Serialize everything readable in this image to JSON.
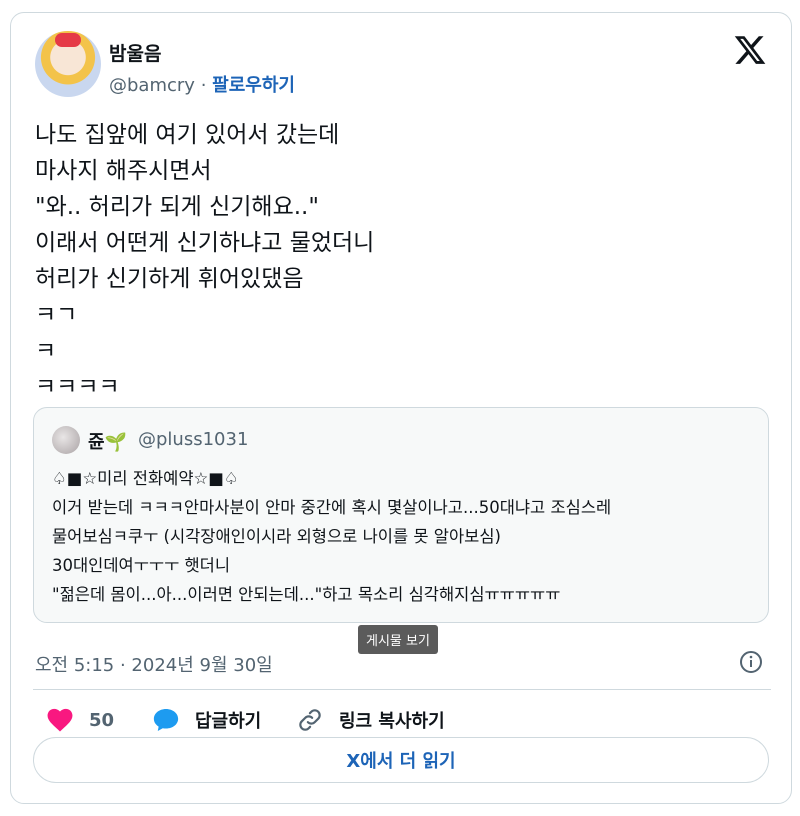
{
  "author": {
    "display_name": "밤울음",
    "handle": "@bamcry",
    "separator": "·",
    "follow_label": "팔로우하기"
  },
  "tweet": {
    "lines": [
      "나도 집앞에 여기 있어서 갔는데",
      "마사지 해주시면서",
      "\"와.. 허리가 되게 신기해요..\"",
      "이래서 어떤게 신기하냐고 물었더니",
      "허리가 신기하게 휘어있댔음",
      "ㅋㄱ",
      "ㅋ",
      "ㅋㅋㅋㅋ"
    ]
  },
  "quote": {
    "display_name": "쥰",
    "sprout": "🌱",
    "handle": "@pluss1031",
    "lines": [
      "♤■☆미리 전화예약☆■♤",
      "이거 받는데 ㅋㅋㅋ안마사분이 안마 중간에 혹시 몇살이나고...50대냐고 조심스레",
      "물어보심ㅋ쿠ㅜ (시각장애인이시라 외형으로  나이를 못 알아보심)",
      "30대인데여ㅜㅜㅜ 햇더니",
      "\"젊은데 몸이...아...이러면 안되는데...\"하고 목소리 심각해지심ㅠㅠㅠㅠㅠ"
    ]
  },
  "tooltip": "게시물 보기",
  "timestamp": "오전 5:15 · 2024년 9월 30일",
  "actions": {
    "like_count": "50",
    "reply_label": "답글하기",
    "copy_label": "링크 복사하기"
  },
  "read_more_label": "X에서 더 읽기",
  "colors": {
    "like": "#f91880",
    "reply": "#1d9bf0",
    "link": "#1d64b7",
    "border": "#cfd9de"
  },
  "icons": [
    "x-logo-icon",
    "heart-icon",
    "reply-bubble-icon",
    "link-icon",
    "info-icon"
  ]
}
